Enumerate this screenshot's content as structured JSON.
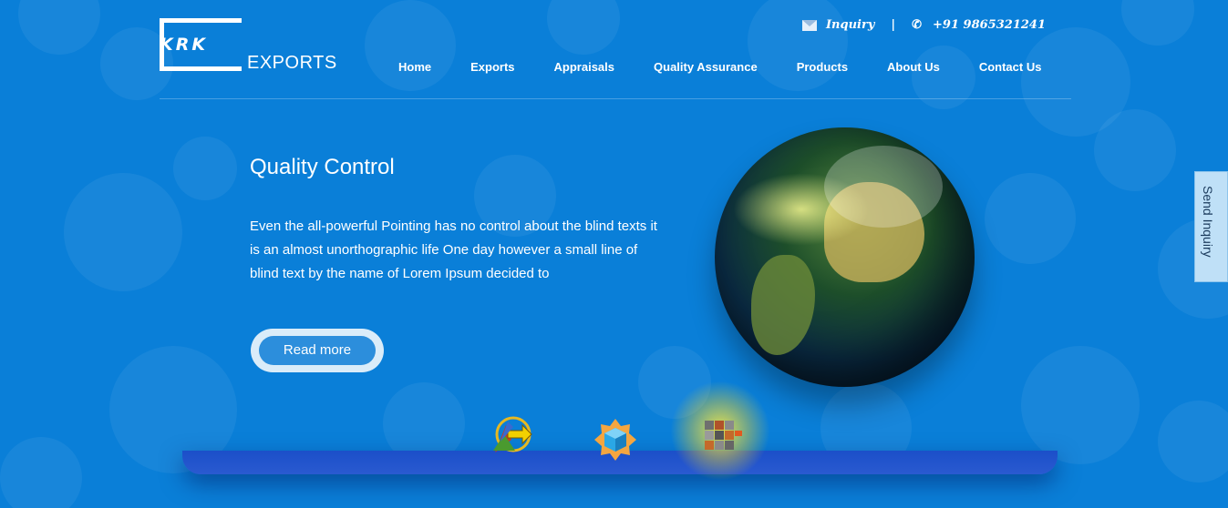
{
  "brand": {
    "mark": "KRK",
    "name": "EXPORTS"
  },
  "topbar": {
    "inquiry": "Inquiry",
    "separator": "|",
    "phone": "+91 9865321241"
  },
  "nav": [
    "Home",
    "Exports",
    "Appraisals",
    "Quality Assurance",
    "Products",
    "About Us",
    "Contact Us"
  ],
  "hero": {
    "title": "Quality Control",
    "text": "Even the all-powerful Pointing has no control about the blind texts it is an almost unorthographic life One day however a small line of blind text by the name of Lorem Ipsum decided to",
    "button": "Read more"
  },
  "sidebar": {
    "send_inquiry": "Send Inquiry"
  },
  "icons": [
    "arrows-icon",
    "cube-gear-icon",
    "cubes-icon"
  ],
  "colors": {
    "background": "#0a7fd8",
    "button": "#2c8edc",
    "shelf": "#1b4fc9"
  }
}
